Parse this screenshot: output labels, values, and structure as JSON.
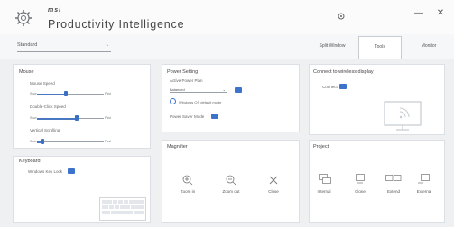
{
  "app": {
    "brand": "msi",
    "title": "Productivity Intelligence"
  },
  "window": {
    "minimize": "—",
    "close": "✕"
  },
  "profile": {
    "selected": "Standard"
  },
  "tabs": [
    {
      "label": "Split Window",
      "active": false
    },
    {
      "label": "Tools",
      "active": true
    },
    {
      "label": "Monitor"
    }
  ],
  "mouse": {
    "title": "Mouse",
    "sliders": [
      {
        "label": "Mouse Speed",
        "min": "Slow",
        "max": "Fast",
        "value": 0.45
      },
      {
        "label": "Double-Click Speed",
        "min": "Slow",
        "max": "Fast",
        "value": 0.6
      },
      {
        "label": "Vertical Scrolling",
        "min": "Slow",
        "max": "Fast",
        "value": 0.1
      }
    ]
  },
  "keyboard": {
    "title": "Keyboard",
    "item_label": "Windows Key Lock"
  },
  "power": {
    "title": "Power Setting",
    "plan_label": "Active Power Plan",
    "plan_value": "Balanced",
    "info_text": "Windows OS default mode",
    "saver_label": "Power Saver Mode"
  },
  "display": {
    "title": "Connect to wireless display",
    "toggle_label": "Connect"
  },
  "magnifier": {
    "title": "Magnifier",
    "actions": [
      {
        "label": "Zoom in",
        "icon": "zoom-in-icon"
      },
      {
        "label": "Zoom out",
        "icon": "zoom-out-icon"
      },
      {
        "label": "Close",
        "icon": "close-icon"
      }
    ]
  },
  "project": {
    "title": "Project",
    "actions": [
      {
        "label": "Internal",
        "icon": "internal-display-icon"
      },
      {
        "label": "Clone",
        "icon": "clone-display-icon"
      },
      {
        "label": "Extend",
        "icon": "extend-display-icon"
      },
      {
        "label": "External",
        "icon": "external-display-icon"
      }
    ]
  },
  "colors": {
    "accent": "#3d73cc",
    "background": "#eef0f2",
    "panel": "#ffffff"
  }
}
